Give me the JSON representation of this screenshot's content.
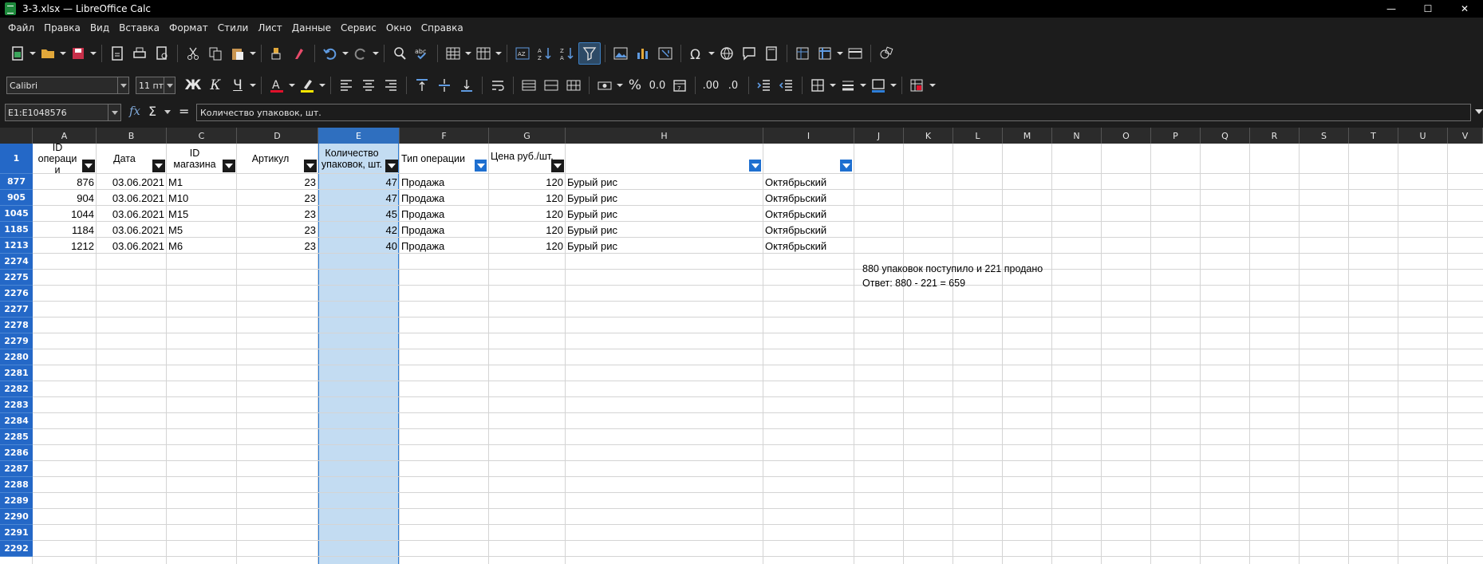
{
  "window": {
    "title": "3-3.xlsx — LibreOffice Calc",
    "minimize": "—",
    "maximize": "☐",
    "close": "✕"
  },
  "menu": [
    "Файл",
    "Правка",
    "Вид",
    "Вставка",
    "Формат",
    "Стили",
    "Лист",
    "Данные",
    "Сервис",
    "Окно",
    "Справка"
  ],
  "font_toolbar": {
    "font_name": "Calibri",
    "font_size": "11 пт",
    "bold": "Ж",
    "italic": "К",
    "underline": "Ч",
    "percent": "%",
    "number_format": "0.0",
    "add_decimal": ".00",
    "delete_decimal": ".0"
  },
  "formula_bar": {
    "name_box": "E1:E1048576",
    "fx": "fx",
    "sigma": "Σ",
    "equals": "=",
    "content": "Количество упаковок, шт."
  },
  "columns": [
    "A",
    "B",
    "C",
    "D",
    "E",
    "F",
    "G",
    "H",
    "I",
    "J",
    "K",
    "L",
    "M",
    "N",
    "O",
    "P",
    "Q",
    "R",
    "S",
    "T",
    "U",
    "V"
  ],
  "selected_column": "E",
  "header_row": {
    "row_label": "1",
    "cells": [
      "ID операци и",
      "Дата",
      "ID магазина",
      "Артикул",
      "Количество упаковок, шт.",
      "Тип операции",
      "Цена руб./шт.",
      "",
      ""
    ]
  },
  "rows": [
    {
      "label": "877",
      "cells": [
        "876",
        "03.06.2021",
        "M1",
        "23",
        "47",
        "Продажа",
        "120",
        "Бурый рис",
        "Октябрьский"
      ]
    },
    {
      "label": "905",
      "cells": [
        "904",
        "03.06.2021",
        "M10",
        "23",
        "47",
        "Продажа",
        "120",
        "Бурый рис",
        "Октябрьский"
      ]
    },
    {
      "label": "1045",
      "cells": [
        "1044",
        "03.06.2021",
        "M15",
        "23",
        "45",
        "Продажа",
        "120",
        "Бурый рис",
        "Октябрьский"
      ]
    },
    {
      "label": "1185",
      "cells": [
        "1184",
        "03.06.2021",
        "M5",
        "23",
        "42",
        "Продажа",
        "120",
        "Бурый рис",
        "Октябрьский"
      ]
    },
    {
      "label": "1213",
      "cells": [
        "1212",
        "03.06.2021",
        "M6",
        "23",
        "40",
        "Продажа",
        "120",
        "Бурый рис",
        "Октябрьский"
      ]
    }
  ],
  "empty_rows": [
    "2274",
    "2275",
    "2276",
    "2277",
    "2278",
    "2279",
    "2280",
    "2281",
    "2282",
    "2283",
    "2284",
    "2285",
    "2286",
    "2287",
    "2288",
    "2289",
    "2290",
    "2291",
    "2292"
  ],
  "notes": {
    "line1": "880 упаковок поступило и 221 продано",
    "line2": "Ответ: 880 - 221 = 659"
  },
  "colors": {
    "selection": "#c3dcf2",
    "row_header": "#2468c7",
    "accent": "#2f7fd8"
  }
}
